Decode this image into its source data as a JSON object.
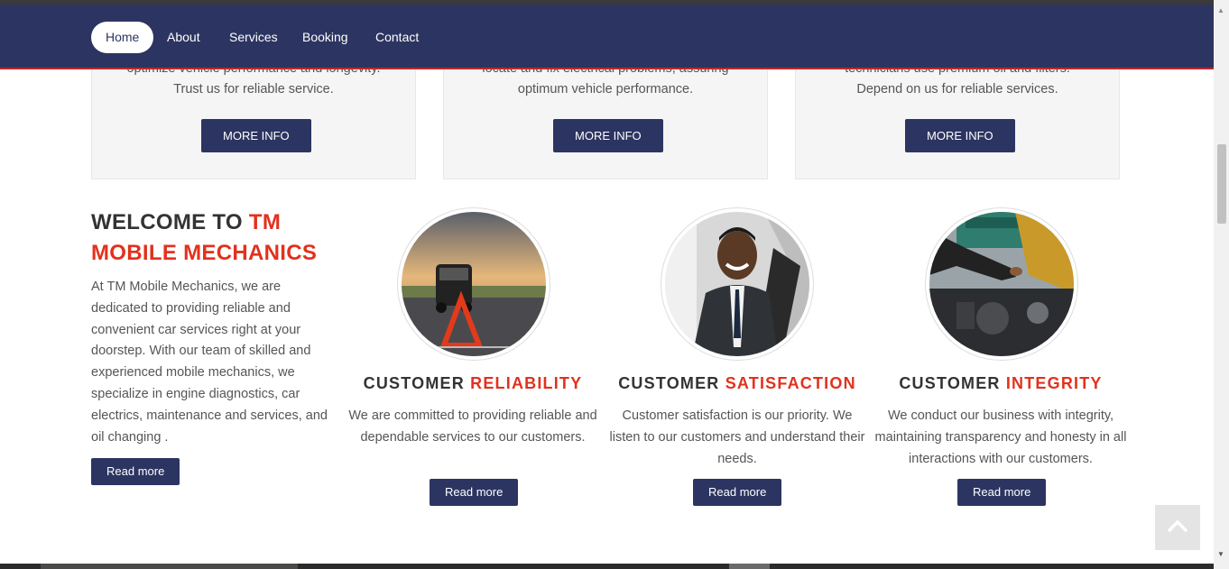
{
  "nav": {
    "items": [
      {
        "label": "Home",
        "active": true
      },
      {
        "label": "About"
      },
      {
        "label": "Services"
      },
      {
        "label": "Booking"
      },
      {
        "label": "Contact"
      }
    ]
  },
  "services": [
    {
      "line1": "optimize vehicle performance and longevity.",
      "line2": "Trust us for reliable service.",
      "button": "MORE INFO"
    },
    {
      "line1": "locate and fix electrical problems, assuring",
      "line2": "optimum vehicle performance.",
      "button": "MORE INFO"
    },
    {
      "line1": "technicians use premium oil and filters.",
      "line2": "Depend on us for reliable services.",
      "button": "MORE INFO"
    }
  ],
  "welcome": {
    "title_plain": "WELCOME TO ",
    "title_highlight": "TM MOBILE MECHANICS",
    "text": "At TM Mobile Mechanics, we are dedicated to providing reliable and convenient car services right at your doorstep. With our team of skilled and experienced mobile mechanics, we specialize in engine diagnostics, car electrics, maintenance and services, and oil changing .",
    "button": "Read more"
  },
  "features": [
    {
      "title_plain": "CUSTOMER ",
      "title_highlight": "RELIABILITY",
      "text": "We are committed to providing reliable and dependable services to our customers.",
      "button": "Read more",
      "image": "roadside-warning-triangle-photo"
    },
    {
      "title_plain": "CUSTOMER ",
      "title_highlight": "SATISFACTION",
      "text": "Customer satisfaction is our priority. We listen to our customers and understand their needs.",
      "button": "Read more",
      "image": "smiling-man-in-car-photo"
    },
    {
      "title_plain": "CUSTOMER ",
      "title_highlight": "INTEGRITY",
      "text": "We conduct our business with integrity, maintaining transparency and honesty in all interactions with our customers.",
      "button": "Read more",
      "image": "open-car-hood-photo"
    }
  ],
  "icons": {
    "back_to_top": "chevron-up-icon"
  },
  "colors": {
    "navy": "#2c3561",
    "accent_red": "#e2311d",
    "card_bg": "#f5f5f5"
  }
}
